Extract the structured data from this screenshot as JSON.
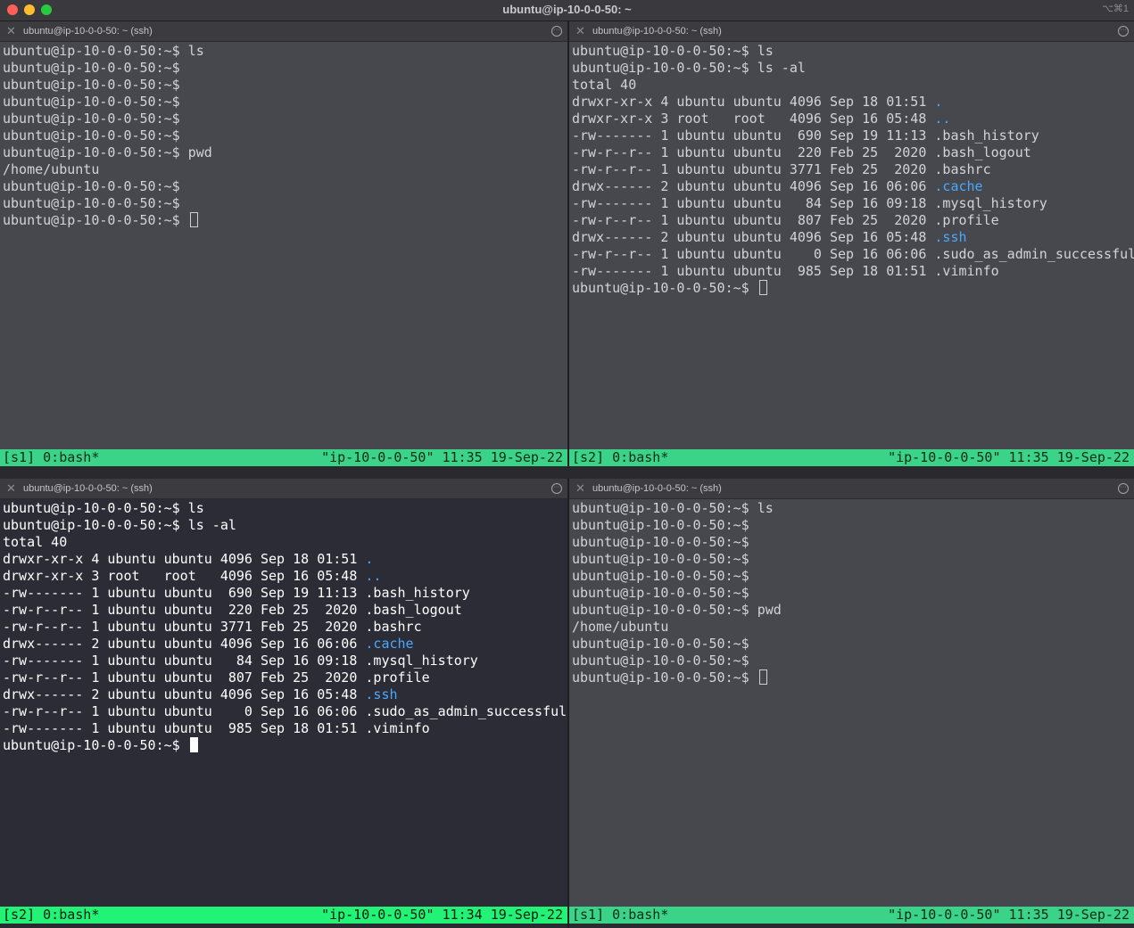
{
  "window": {
    "title": "ubuntu@ip-10-0-0-50: ~",
    "shortcut": "⌥⌘1"
  },
  "panes": [
    {
      "header": "ubuntu@ip-10-0-0-50: ~ (ssh)",
      "lines": [
        "ubuntu@ip-10-0-0-50:~$ ls",
        "ubuntu@ip-10-0-0-50:~$",
        "ubuntu@ip-10-0-0-50:~$",
        "ubuntu@ip-10-0-0-50:~$",
        "ubuntu@ip-10-0-0-50:~$",
        "ubuntu@ip-10-0-0-50:~$",
        "ubuntu@ip-10-0-0-50:~$ pwd",
        "/home/ubuntu",
        "ubuntu@ip-10-0-0-50:~$",
        "ubuntu@ip-10-0-0-50:~$"
      ],
      "prompt": "ubuntu@ip-10-0-0-50:~$ ",
      "status_left": "[s1] 0:bash*",
      "status_right": "\"ip-10-0-0-50\" 11:35 19-Sep-22"
    },
    {
      "header": "ubuntu@ip-10-0-0-50: ~ (ssh)",
      "lines": [
        "ubuntu@ip-10-0-0-50:~$ ls",
        "ubuntu@ip-10-0-0-50:~$ ls -al",
        "total 40",
        {
          "t": "drwxr-xr-x 4 ubuntu ubuntu 4096 Sep 18 01:51 ",
          "n": ".",
          "d": true
        },
        {
          "t": "drwxr-xr-x 3 root   root   4096 Sep 16 05:48 ",
          "n": "..",
          "d": true
        },
        {
          "t": "-rw------- 1 ubuntu ubuntu  690 Sep 19 11:13 ",
          "n": ".bash_history",
          "d": false
        },
        {
          "t": "-rw-r--r-- 1 ubuntu ubuntu  220 Feb 25  2020 ",
          "n": ".bash_logout",
          "d": false
        },
        {
          "t": "-rw-r--r-- 1 ubuntu ubuntu 3771 Feb 25  2020 ",
          "n": ".bashrc",
          "d": false
        },
        {
          "t": "drwx------ 2 ubuntu ubuntu 4096 Sep 16 06:06 ",
          "n": ".cache",
          "d": true
        },
        {
          "t": "-rw------- 1 ubuntu ubuntu   84 Sep 16 09:18 ",
          "n": ".mysql_history",
          "d": false
        },
        {
          "t": "-rw-r--r-- 1 ubuntu ubuntu  807 Feb 25  2020 ",
          "n": ".profile",
          "d": false
        },
        {
          "t": "drwx------ 2 ubuntu ubuntu 4096 Sep 16 05:48 ",
          "n": ".ssh",
          "d": true
        },
        {
          "t": "-rw-r--r-- 1 ubuntu ubuntu    0 Sep 16 06:06 ",
          "n": ".sudo_as_admin_successful",
          "d": false
        },
        {
          "t": "-rw------- 1 ubuntu ubuntu  985 Sep 18 01:51 ",
          "n": ".viminfo",
          "d": false
        }
      ],
      "prompt": "ubuntu@ip-10-0-0-50:~$ ",
      "status_left": "[s2] 0:bash*",
      "status_right": "\"ip-10-0-0-50\" 11:35 19-Sep-22"
    },
    {
      "header": "ubuntu@ip-10-0-0-50: ~ (ssh)",
      "lines": [
        "ubuntu@ip-10-0-0-50:~$ ls",
        "ubuntu@ip-10-0-0-50:~$ ls -al",
        "total 40",
        {
          "t": "drwxr-xr-x 4 ubuntu ubuntu 4096 Sep 18 01:51 ",
          "n": ".",
          "d": true
        },
        {
          "t": "drwxr-xr-x 3 root   root   4096 Sep 16 05:48 ",
          "n": "..",
          "d": true
        },
        {
          "t": "-rw------- 1 ubuntu ubuntu  690 Sep 19 11:13 ",
          "n": ".bash_history",
          "d": false
        },
        {
          "t": "-rw-r--r-- 1 ubuntu ubuntu  220 Feb 25  2020 ",
          "n": ".bash_logout",
          "d": false
        },
        {
          "t": "-rw-r--r-- 1 ubuntu ubuntu 3771 Feb 25  2020 ",
          "n": ".bashrc",
          "d": false
        },
        {
          "t": "drwx------ 2 ubuntu ubuntu 4096 Sep 16 06:06 ",
          "n": ".cache",
          "d": true
        },
        {
          "t": "-rw------- 1 ubuntu ubuntu   84 Sep 16 09:18 ",
          "n": ".mysql_history",
          "d": false
        },
        {
          "t": "-rw-r--r-- 1 ubuntu ubuntu  807 Feb 25  2020 ",
          "n": ".profile",
          "d": false
        },
        {
          "t": "drwx------ 2 ubuntu ubuntu 4096 Sep 16 05:48 ",
          "n": ".ssh",
          "d": true
        },
        {
          "t": "-rw-r--r-- 1 ubuntu ubuntu    0 Sep 16 06:06 ",
          "n": ".sudo_as_admin_successful",
          "d": false
        },
        {
          "t": "-rw------- 1 ubuntu ubuntu  985 Sep 18 01:51 ",
          "n": ".viminfo",
          "d": false
        }
      ],
      "prompt": "ubuntu@ip-10-0-0-50:~$ ",
      "status_left": "[s2] 0:bash*",
      "status_right": "\"ip-10-0-0-50\" 11:34 19-Sep-22"
    },
    {
      "header": "ubuntu@ip-10-0-0-50: ~ (ssh)",
      "lines": [
        "ubuntu@ip-10-0-0-50:~$ ls",
        "ubuntu@ip-10-0-0-50:~$",
        "ubuntu@ip-10-0-0-50:~$",
        "ubuntu@ip-10-0-0-50:~$",
        "ubuntu@ip-10-0-0-50:~$",
        "ubuntu@ip-10-0-0-50:~$",
        "ubuntu@ip-10-0-0-50:~$ pwd",
        "/home/ubuntu",
        "ubuntu@ip-10-0-0-50:~$",
        "ubuntu@ip-10-0-0-50:~$"
      ],
      "prompt": "ubuntu@ip-10-0-0-50:~$ ",
      "status_left": "[s1] 0:bash*",
      "status_right": "\"ip-10-0-0-50\" 11:35 19-Sep-22"
    }
  ],
  "colors": {
    "directory": "#4aa8ff",
    "status_bar_inactive": "#3ad387",
    "status_bar_active": "#22f276",
    "pane_bg_inactive": "#47474e",
    "pane_bg_active": "#2b2c36"
  },
  "icons": {
    "pane_close": "close-icon",
    "pane_menu": "more-options-icon"
  }
}
